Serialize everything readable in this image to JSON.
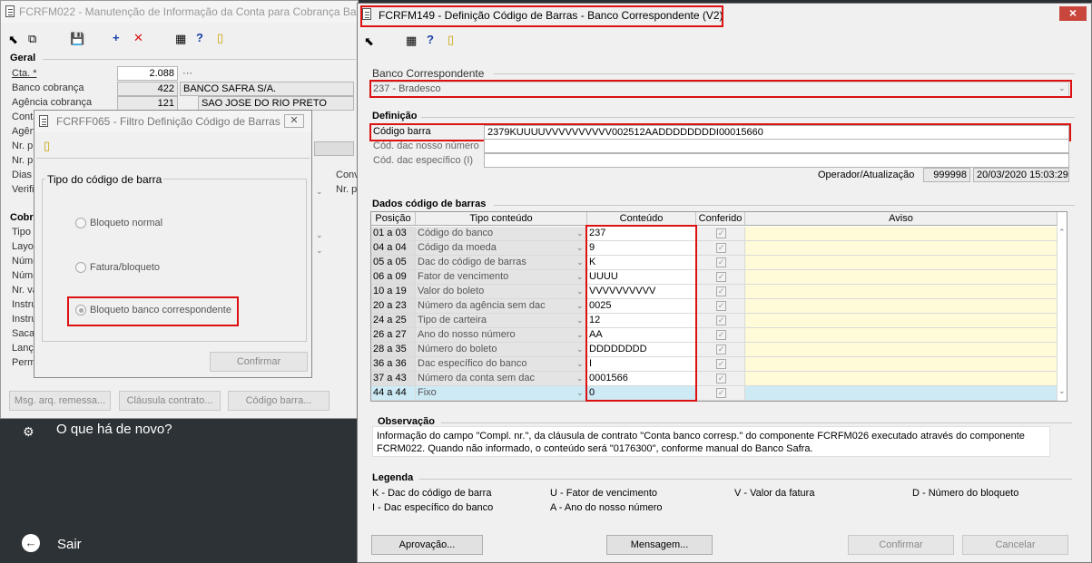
{
  "bg_window": {
    "title": "FCRFM022 - Manutenção de Informação da Conta para Cobrança Banc",
    "geral_label": "Geral",
    "cta_label": "Cta. *",
    "cta_value": "2.088",
    "banco_label": "Banco cobrança",
    "banco_code": "422",
    "banco_name": "BANCO SAFRA S/A.",
    "agencia_label": "Agência cobrança",
    "agencia_code": "121",
    "agencia_name": "SAO JOSE DO RIO PRETO",
    "partial_labels": [
      "Conta",
      "Agên",
      "Nr. pr",
      "Nr. pr",
      "Dias",
      "Verifi"
    ],
    "conv_label": "Conv",
    "nrp_label": "Nr. p",
    "cobr_label": "Cobr",
    "partial_labels2": [
      "Tipo c",
      "Layo",
      "Núme",
      "Núme",
      "Nr. va",
      "Instru",
      "Instru",
      "Saca",
      "Lanç",
      "Perm"
    ],
    "buttons": {
      "msg": "Msg. arq. remessa...",
      "clausula": "Cláusula contrato...",
      "codigo": "Código barra..."
    }
  },
  "dark_area": {
    "whats_new": "O que há de novo?",
    "sair": "Sair"
  },
  "filter_window": {
    "title": "FCRFF065 - Filtro Definição Código de Barras",
    "group_label": "Tipo do código de barra",
    "options": [
      "Bloqueto normal",
      "Fatura/bloqueto",
      "Bloqueto banco correspondente"
    ],
    "confirm": "Confirmar"
  },
  "main_window": {
    "title": "FCRFM149 - Definição Código de Barras - Banco Correspondente (V2)",
    "close": "×",
    "banco_group": "Banco Correspondente",
    "banco_value": "237 - Bradesco",
    "def_group": "Definição",
    "codigo_barra_label": "Código barra",
    "codigo_barra_value": "2379KUUUUVVVVVVVVVV002512AADDDDDDDDI00015660",
    "dac_nosso_label": "Cód. dac nosso número",
    "dac_especifico_label": "Cód. dac específico (I)",
    "operador_label": "Operador/Atualização",
    "operador_value": "999998",
    "data_value": "20/03/2020 15:03:29",
    "dados_group": "Dados código de barras",
    "columns": [
      "Posição",
      "Tipo conteúdo",
      "Conteúdo",
      "Conferido",
      "Aviso"
    ],
    "rows": [
      {
        "pos": "01 a 03",
        "tipo": "Código do banco",
        "conteudo": "237"
      },
      {
        "pos": "04 a 04",
        "tipo": "Código da moeda",
        "conteudo": "9"
      },
      {
        "pos": "05 a 05",
        "tipo": "Dac do código de barras",
        "conteudo": "K"
      },
      {
        "pos": "06 a 09",
        "tipo": "Fator de vencimento",
        "conteudo": "UUUU"
      },
      {
        "pos": "10 a 19",
        "tipo": "Valor do boleto",
        "conteudo": "VVVVVVVVVV"
      },
      {
        "pos": "20 a 23",
        "tipo": "Número da agência sem dac",
        "conteudo": "0025"
      },
      {
        "pos": "24 a 25",
        "tipo": "Tipo de carteira",
        "conteudo": "12"
      },
      {
        "pos": "26 a 27",
        "tipo": "Ano do nosso número",
        "conteudo": "AA"
      },
      {
        "pos": "28 a 35",
        "tipo": "Número do boleto",
        "conteudo": "DDDDDDDD"
      },
      {
        "pos": "36 a 36",
        "tipo": "Dac específico do banco",
        "conteudo": "I"
      },
      {
        "pos": "37 a 43",
        "tipo": "Número da conta sem dac",
        "conteudo": "0001566"
      },
      {
        "pos": "44 a 44",
        "tipo": "Fixo",
        "conteudo": "0"
      }
    ],
    "obs_group": "Observação",
    "obs_line1": "Informação do campo \"Compl. nr.\", da cláusula de contrato  \"Conta banco corresp.\" do componente FCRFM026 executado através do componente",
    "obs_line2": "FCRM022.  Quando não informado, o conteúdo será \"0176300\", conforme manual do Banco Safra.",
    "legenda_group": "Legenda",
    "legend": [
      "K - Dac do código de barra",
      "U - Fator de vencimento",
      "V - Valor da fatura",
      "D - Número do bloqueto",
      "I - Dac específico do banco",
      "A - Ano do nosso número"
    ],
    "buttons": {
      "aprovacao": "Aprovação...",
      "mensagem": "Mensagem...",
      "confirmar": "Confirmar",
      "cancelar": "Cancelar"
    }
  },
  "colors": {
    "accent_red": "#d11111",
    "title_active": "#f0f0f0",
    "selected_row": "#cdeaf5",
    "aviso_bg": "#fffbd9"
  }
}
